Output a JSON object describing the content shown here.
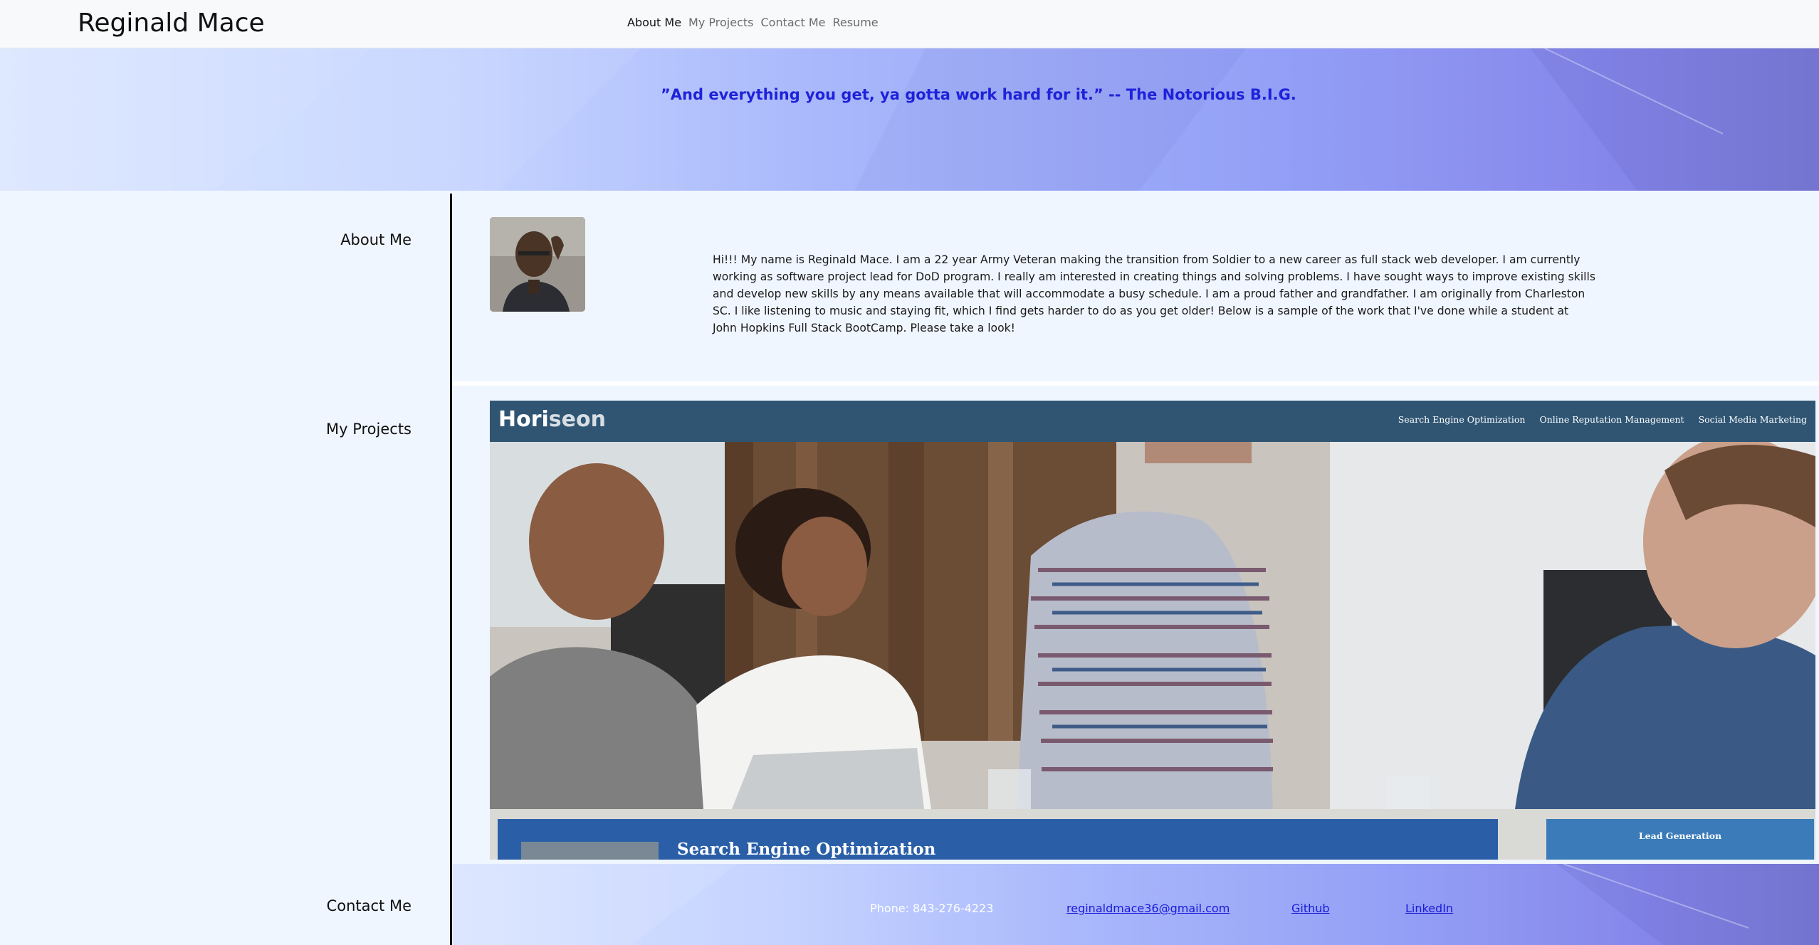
{
  "navbar": {
    "brand": "Reginald Mace",
    "links": [
      {
        "label": "About Me",
        "active": true
      },
      {
        "label": "My Projects",
        "active": false
      },
      {
        "label": "Contact Me",
        "active": false
      },
      {
        "label": "Resume",
        "active": false
      }
    ]
  },
  "hero": {
    "quote": "”And everything you get, ya gotta work hard for it.” -- The Notorious B.I.G."
  },
  "about": {
    "heading": "About Me",
    "bio": "Hi!!! My name is Reginald Mace. I am a 22 year Army Veteran making the transition from Soldier to a new career as full stack web developer. I am currently working as software project lead for DoD program. I really am interested in creating things and solving problems. I have sought ways to improve existing skills and develop new skills by any means available that will accommodate a busy schedule. I am a proud father and grandfather. I am originally from Charleston SC. I like listening to music and staying fit, which I find gets harder to do as you get older! Below is a sample of the work that I've done while a student at John Hopkins Full Stack BootCamp. Please take a look!"
  },
  "projects": {
    "heading": "My Projects",
    "preview": {
      "logo_bold": "Hori",
      "logo_light": "seon",
      "nav": [
        "Search Engine Optimization",
        "Online Reputation Management",
        "Social Media Marketing"
      ],
      "seo_title": "Search Engine Optimization",
      "lead_title": "Lead Generation"
    }
  },
  "contact": {
    "heading": "Contact Me",
    "phone": "Phone: 843-276-4223",
    "email": "reginaldmace36@gmail.com",
    "github": "Github",
    "linkedin": "LinkedIn"
  },
  "colors": {
    "quote": "#1f22d9",
    "project_header": "#2f5573",
    "link": "#1a1ad9"
  }
}
